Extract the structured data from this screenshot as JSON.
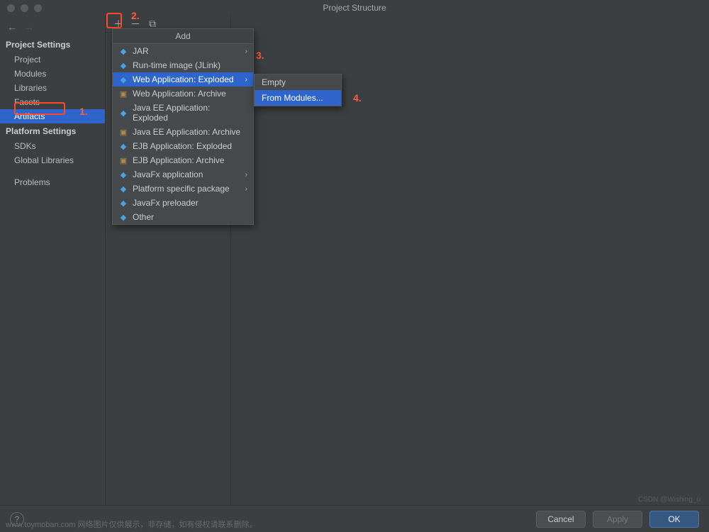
{
  "window": {
    "title": "Project Structure"
  },
  "sidebar": {
    "section1_title": "Project Settings",
    "items1": [
      {
        "label": "Project"
      },
      {
        "label": "Modules"
      },
      {
        "label": "Libraries"
      },
      {
        "label": "Facets"
      },
      {
        "label": "Artifacts",
        "selected": true
      }
    ],
    "section2_title": "Platform Settings",
    "items2": [
      {
        "label": "SDKs"
      },
      {
        "label": "Global Libraries"
      }
    ],
    "problems_label": "Problems"
  },
  "toolbar": {
    "add_icon": "plus-icon",
    "remove_icon": "minus-icon",
    "copy_icon": "copy-icon"
  },
  "add_menu": {
    "title": "Add",
    "items": [
      {
        "label": "JAR",
        "icon": "diamond",
        "submenu": false
      },
      {
        "label": "Run-time image (JLink)",
        "icon": "diamond",
        "submenu": false
      },
      {
        "label": "Web Application: Exploded",
        "icon": "diamond",
        "submenu": true,
        "selected": true
      },
      {
        "label": "Web Application: Archive",
        "icon": "box",
        "submenu": false
      },
      {
        "label": "Java EE Application: Exploded",
        "icon": "diamond",
        "submenu": false
      },
      {
        "label": "Java EE Application: Archive",
        "icon": "box",
        "submenu": false
      },
      {
        "label": "EJB Application: Exploded",
        "icon": "diamond",
        "submenu": false
      },
      {
        "label": "EJB Application: Archive",
        "icon": "box",
        "submenu": false
      },
      {
        "label": "JavaFx application",
        "icon": "diamond",
        "submenu": true
      },
      {
        "label": "Platform specific package",
        "icon": "diamond",
        "submenu": true
      },
      {
        "label": "JavaFx preloader",
        "icon": "diamond",
        "submenu": false
      },
      {
        "label": "Other",
        "icon": "diamond",
        "submenu": false
      }
    ]
  },
  "sub_menu": {
    "items": [
      {
        "label": "Empty"
      },
      {
        "label": "From Modules...",
        "selected": true
      }
    ]
  },
  "annotations": {
    "n1": "1.",
    "n2": "2.",
    "n3": "3.",
    "n4": "4."
  },
  "buttons": {
    "cancel": "Cancel",
    "apply": "Apply",
    "ok": "OK",
    "help": "?"
  },
  "watermark": {
    "left": "www.toymoban.com 网络图片仅供展示，非存储，如有侵权请联系删除。",
    "right": "CSDN @Wishing_u"
  }
}
